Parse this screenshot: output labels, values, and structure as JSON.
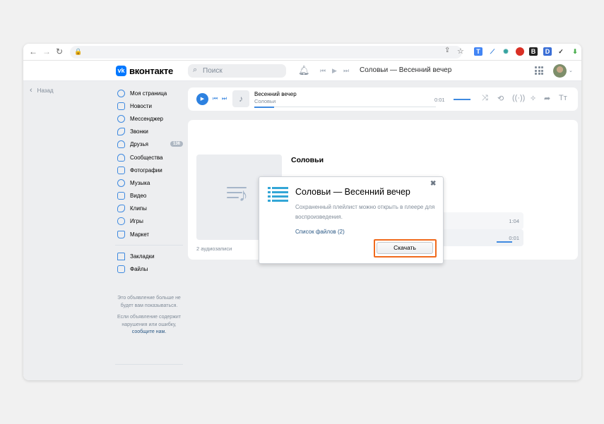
{
  "header": {
    "logo_text": "вконтакте",
    "logo_mark": "vk",
    "search_placeholder": "Поиск",
    "now_playing": "Соловьи — Весенний вечер"
  },
  "back_label": "Назад",
  "sidebar": {
    "items": [
      {
        "label": "Моя страница",
        "icon": "user-circle-icon"
      },
      {
        "label": "Новости",
        "icon": "news-icon"
      },
      {
        "label": "Мессенджер",
        "icon": "message-icon"
      },
      {
        "label": "Звонки",
        "icon": "phone-icon"
      },
      {
        "label": "Друзья",
        "icon": "friends-icon",
        "badge": "136"
      },
      {
        "label": "Сообщества",
        "icon": "communities-icon"
      },
      {
        "label": "Фотографии",
        "icon": "photo-icon"
      },
      {
        "label": "Музыка",
        "icon": "music-icon"
      },
      {
        "label": "Видео",
        "icon": "video-icon"
      },
      {
        "label": "Клипы",
        "icon": "clips-icon"
      },
      {
        "label": "Игры",
        "icon": "games-icon"
      },
      {
        "label": "Маркет",
        "icon": "market-icon"
      }
    ],
    "secondary": [
      {
        "label": "Закладки",
        "icon": "bookmark-icon"
      },
      {
        "label": "Файлы",
        "icon": "files-icon"
      }
    ],
    "ad_note_1": "Это объявление больше не будет вам показываться.",
    "ad_note_2": "Если объявление содержит нарушения или ошибку,",
    "ad_note_link": "сообщите нам."
  },
  "player": {
    "title": "Весенний вечер",
    "artist": "Соловьи",
    "time": "0:01",
    "progress": 0.11
  },
  "playlist": {
    "title": "Соловьи",
    "count": "2 аудиозаписи",
    "rows": [
      {
        "time": "1:04"
      },
      {
        "time": "0:01"
      }
    ]
  },
  "modal": {
    "title": "Соловьи — Весенний вечер",
    "text": "Сохраненный плейлист можно открыть в плеере для воспроизведения.",
    "link": "Список файлов (2)",
    "button": "Скачать",
    "close": "✖"
  },
  "colors": {
    "accent": "#0077ff",
    "link": "#2a5885",
    "highlight": "#f06a1d"
  }
}
